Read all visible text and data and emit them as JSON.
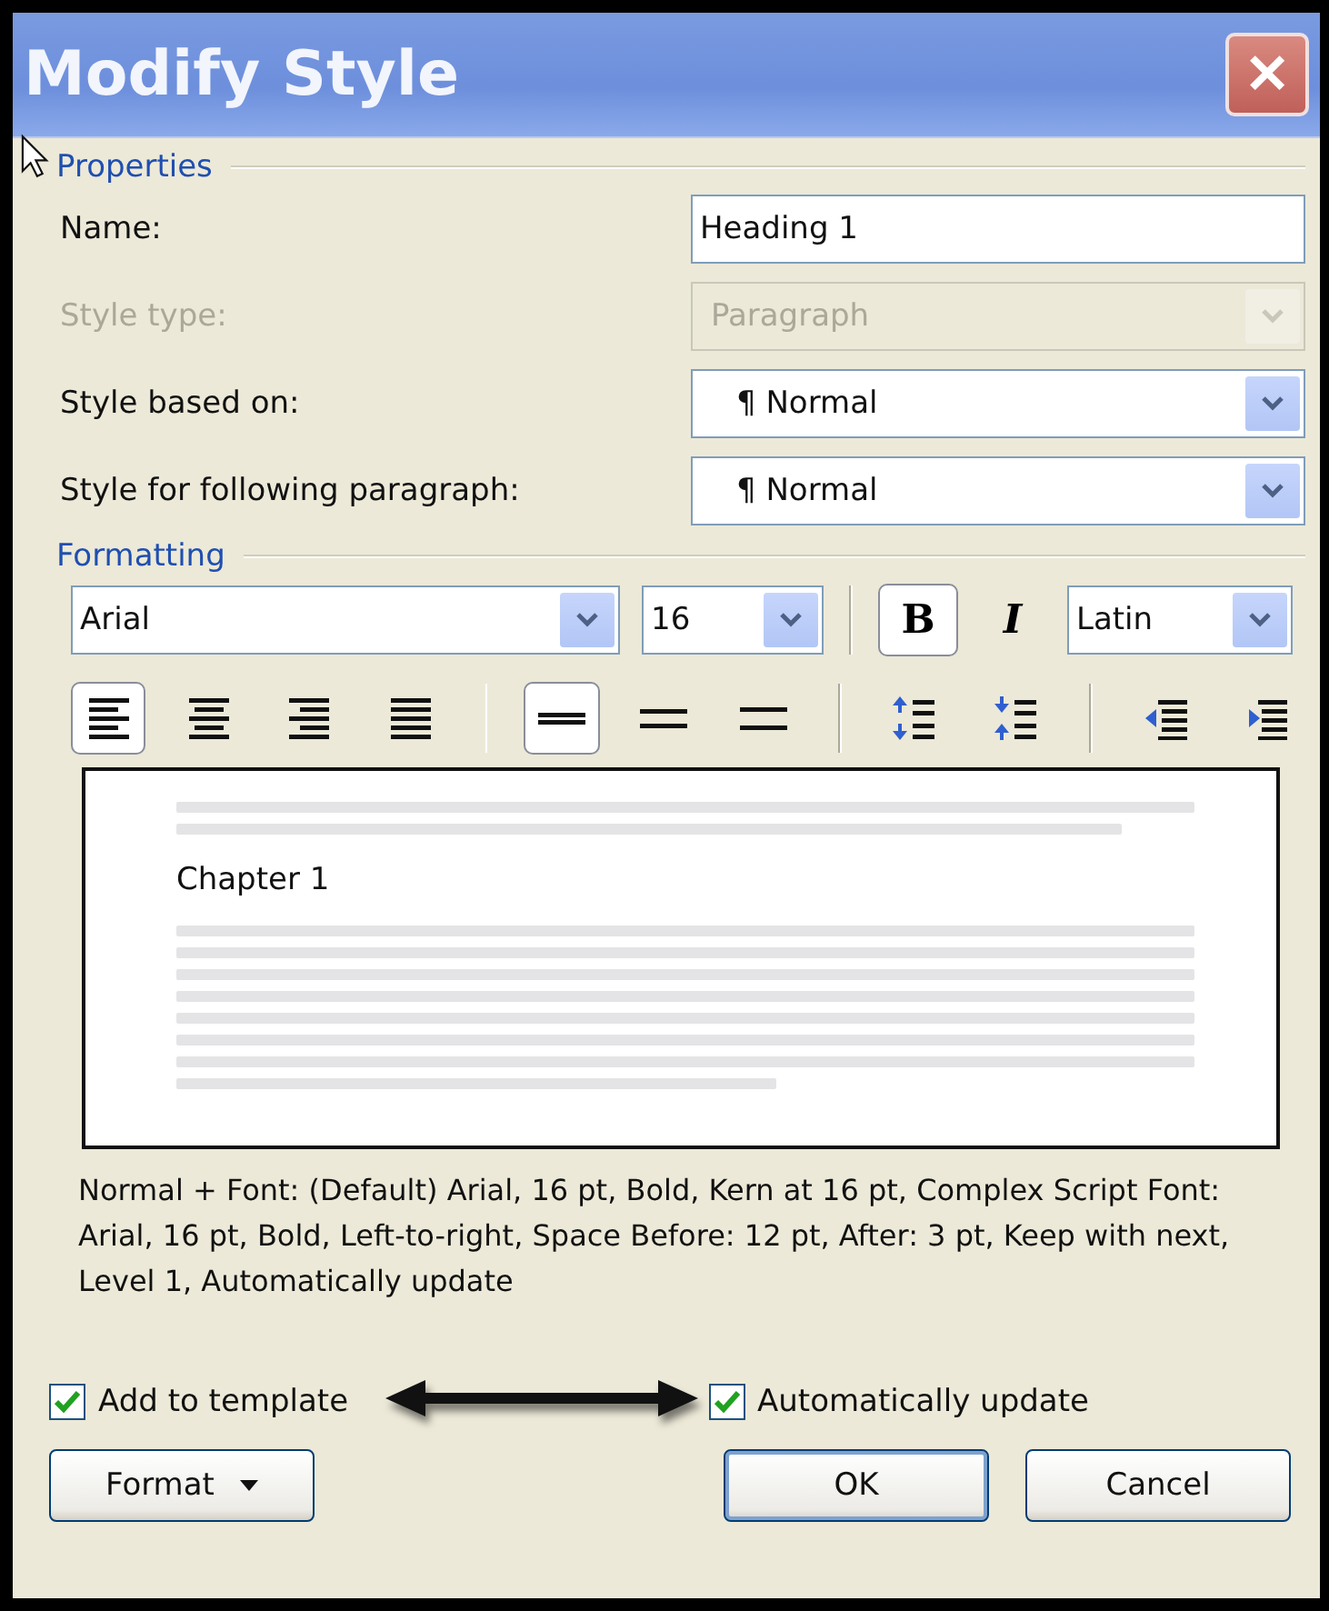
{
  "window": {
    "title": "Modify Style",
    "close": "✕"
  },
  "properties": {
    "legend": "Properties",
    "fields": [
      {
        "label": "Name:",
        "kind": "text",
        "value": "Heading 1",
        "disabled": false
      },
      {
        "label": "Style type:",
        "kind": "dropdown",
        "value": "Paragraph",
        "disabled": true
      },
      {
        "label": "Style based on:",
        "kind": "dropdown",
        "value": "¶ Normal",
        "disabled": false
      },
      {
        "label": "Style for following paragraph:",
        "kind": "dropdown",
        "value": "¶ Normal",
        "disabled": false
      }
    ]
  },
  "formatting": {
    "legend": "Formatting",
    "font": "Arial",
    "size": "16",
    "bold": {
      "label": "B",
      "selected": true
    },
    "italic": {
      "label": "I",
      "selected": false
    },
    "script": "Latin",
    "tools": [
      {
        "kind": "align-left",
        "selected": true
      },
      {
        "kind": "align-center",
        "selected": false
      },
      {
        "kind": "align-right",
        "selected": false
      },
      {
        "kind": "justify",
        "selected": false
      },
      {
        "kind": "separator"
      },
      {
        "kind": "single-spacing",
        "selected": true
      },
      {
        "kind": "one-half-spacing",
        "selected": false
      },
      {
        "kind": "double-spacing",
        "selected": false
      },
      {
        "kind": "separator"
      },
      {
        "kind": "increase-space",
        "selected": false
      },
      {
        "kind": "decrease-space",
        "selected": false
      },
      {
        "kind": "separator"
      },
      {
        "kind": "decrease-indent",
        "selected": false
      },
      {
        "kind": "increase-indent",
        "selected": false
      }
    ],
    "preview": {
      "sample": "Chapter 1"
    }
  },
  "description": "Normal + Font: (Default) Arial, 16 pt, Bold, Kern at 16 pt, Complex Script Font: Arial, 16 pt, Bold, Left-to-right, Space Before:  12 pt, After:  3 pt, Keep with next, Level 1, Automatically update",
  "options": [
    {
      "label": "Add to template",
      "checked": true
    },
    {
      "label": "Automatically update",
      "checked": true
    }
  ],
  "buttons": {
    "format": "Format",
    "ok": "OK",
    "cancel": "Cancel"
  }
}
